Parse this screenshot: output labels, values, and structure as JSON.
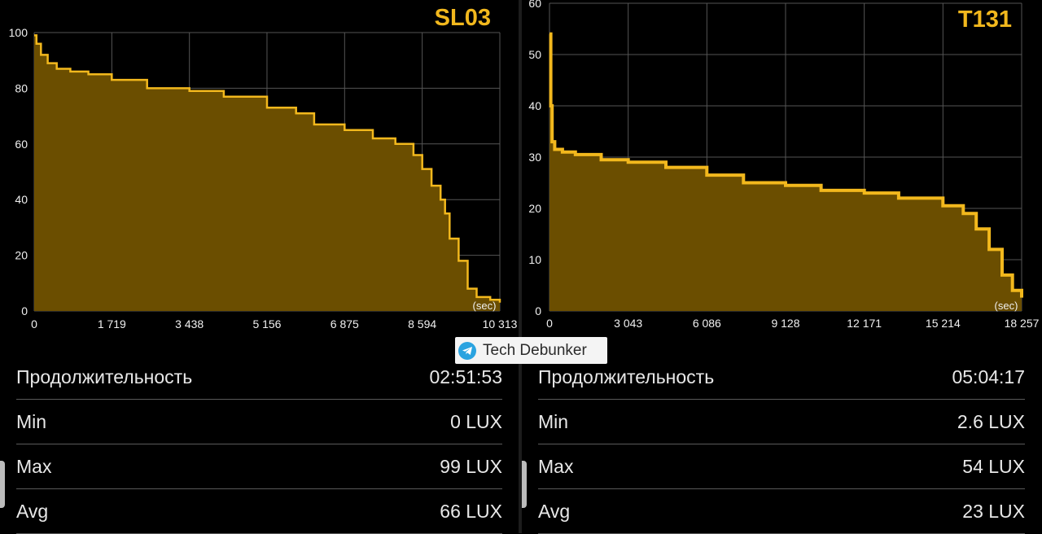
{
  "watermark": {
    "text": "Tech Debunker",
    "icon": "telegram-icon"
  },
  "colors": {
    "accent": "#f2b81d",
    "fill": "#6b4e00",
    "grid": "#555555",
    "background": "#000000"
  },
  "panels": [
    {
      "title": "SL03",
      "unit_label": "(sec)",
      "stats": [
        {
          "label": "Продолжительность",
          "value": "02:51:53"
        },
        {
          "label": "Min",
          "value": "0 LUX"
        },
        {
          "label": "Max",
          "value": "99 LUX"
        },
        {
          "label": "Avg",
          "value": "66 LUX"
        }
      ]
    },
    {
      "title": "T131",
      "unit_label": "(sec)",
      "stats": [
        {
          "label": "Продолжительность",
          "value": "05:04:17"
        },
        {
          "label": "Min",
          "value": "2.6 LUX"
        },
        {
          "label": "Max",
          "value": "54 LUX"
        },
        {
          "label": "Avg",
          "value": "23 LUX"
        }
      ]
    }
  ],
  "chart_data": [
    {
      "type": "area",
      "title": "SL03",
      "xlabel": "(sec)",
      "ylabel": "",
      "xlim": [
        0,
        10313
      ],
      "ylim": [
        0,
        100
      ],
      "x_ticks": [
        "0",
        "1 719",
        "3 438",
        "5 156",
        "6 875",
        "8 594",
        "10 313"
      ],
      "y_ticks": [
        "0",
        "20",
        "40",
        "60",
        "80",
        "100"
      ],
      "grid": true,
      "series": [
        {
          "x": [
            0,
            50,
            150,
            300,
            500,
            800,
            1200,
            1719,
            2500,
            3438,
            4200,
            5156,
            5800,
            6200,
            6875,
            7500,
            8000,
            8400,
            8594,
            8800,
            9000,
            9100,
            9200,
            9400,
            9600,
            9800,
            10100,
            10313
          ],
          "y": [
            99,
            96,
            92,
            89,
            87,
            86,
            85,
            83,
            80,
            79,
            77,
            73,
            71,
            67,
            65,
            62,
            60,
            56,
            51,
            45,
            40,
            35,
            26,
            18,
            8,
            5,
            4,
            3
          ]
        }
      ]
    },
    {
      "type": "area",
      "title": "T131",
      "xlabel": "(sec)",
      "ylabel": "",
      "xlim": [
        0,
        18257
      ],
      "ylim": [
        0,
        60
      ],
      "x_ticks": [
        "0",
        "3 043",
        "6 086",
        "9 128",
        "12 171",
        "15 214",
        "18 257"
      ],
      "y_ticks": [
        "0",
        "10",
        "20",
        "30",
        "40",
        "50",
        "60"
      ],
      "grid": true,
      "series": [
        {
          "x": [
            0,
            50,
            100,
            200,
            500,
            1000,
            2000,
            3043,
            4500,
            6086,
            7500,
            9128,
            10500,
            12171,
            13500,
            15214,
            16000,
            16500,
            17000,
            17500,
            17900,
            18257
          ],
          "y": [
            54,
            40,
            33,
            31.5,
            31,
            30.5,
            29.5,
            29,
            28,
            26.5,
            25,
            24.5,
            23.5,
            23,
            22,
            20.5,
            19,
            16,
            12,
            7,
            4,
            2.6
          ]
        }
      ]
    }
  ]
}
